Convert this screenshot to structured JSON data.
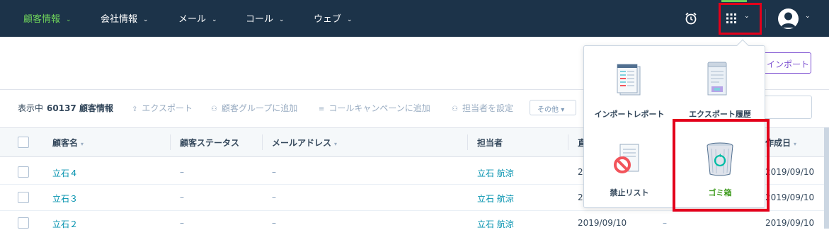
{
  "nav": {
    "items": [
      {
        "label": "顧客情報",
        "active": true
      },
      {
        "label": "会社情報",
        "active": false
      },
      {
        "label": "メール",
        "active": false
      },
      {
        "label": "コール",
        "active": false
      },
      {
        "label": "ウェブ",
        "active": false
      }
    ],
    "icons": [
      "alarm-clock-icon",
      "apps-grid-icon",
      "avatar-icon"
    ],
    "accent_color": "#6ed15a",
    "bar_color": "#1c3349"
  },
  "header": {
    "import_button": "インポート"
  },
  "actions": {
    "showing_prefix": "表示中",
    "showing_count": "60137 顧客情報",
    "export": "エクスポート",
    "add_to_group": "顧客グループに追加",
    "add_to_campaign": "コールキャンペーンに追加",
    "set_owner": "担当者を設定",
    "more": "その他"
  },
  "table": {
    "columns": [
      "顧客名",
      "顧客ステータス",
      "メールアドレス",
      "担当者",
      "直",
      "作成日"
    ],
    "rows": [
      {
        "name": "立石４",
        "status": "–",
        "email": "–",
        "owner": "立石 航涼",
        "d1": "2",
        "created": "2019/09/10"
      },
      {
        "name": "立石３",
        "status": "–",
        "email": "–",
        "owner": "立石 航涼",
        "d1": "2",
        "created": "2019/09/10"
      },
      {
        "name": "立石２",
        "status": "–",
        "email": "–",
        "owner": "立石 航涼",
        "d1": "2019/09/10",
        "d2": "–",
        "created": "2019/09/10"
      }
    ]
  },
  "apps_menu": {
    "tiles": [
      {
        "label": "インポートレポート",
        "icon": "import-report-icon"
      },
      {
        "label": "エクスポート履歴",
        "icon": "export-history-icon"
      },
      {
        "label": "禁止リスト",
        "icon": "blocked-list-icon"
      },
      {
        "label": "ゴミ箱",
        "icon": "recycle-bin-icon",
        "highlight": true
      }
    ],
    "highlight_color": "#e3001b"
  }
}
